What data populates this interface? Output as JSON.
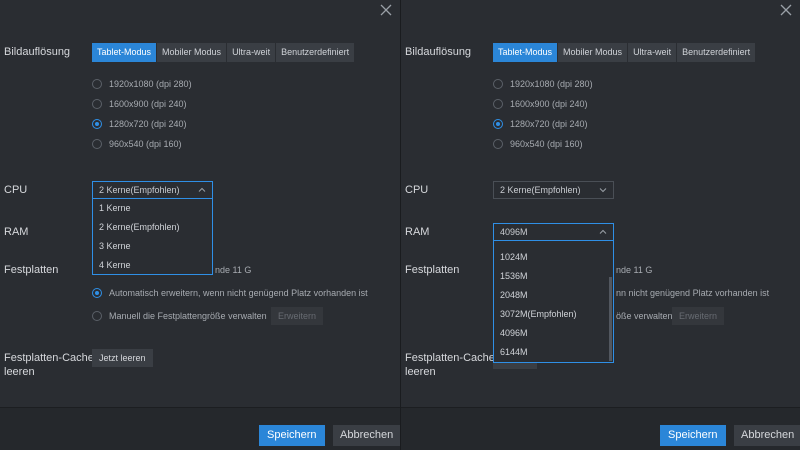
{
  "labels": {
    "resolution": "Bildauflösung",
    "cpu": "CPU",
    "ram": "RAM",
    "disks": "Festplatten",
    "cache_line1": "Festplatten-Cache",
    "cache_line2": "leeren"
  },
  "resolution_modes": [
    "Tablet-Modus",
    "Mobiler Modus",
    "Ultra-weit",
    "Benutzerdefiniert"
  ],
  "active_mode": "Tablet-Modus",
  "resolutions": [
    {
      "label": "1920x1080  (dpi 280)",
      "checked": false
    },
    {
      "label": "1600x900  (dpi 240)",
      "checked": false
    },
    {
      "label": "1280x720  (dpi 240)",
      "checked": true
    },
    {
      "label": "960x540  (dpi 160)",
      "checked": false
    }
  ],
  "cpu": {
    "value": "2 Kerne(Empfohlen)",
    "options": [
      "1 Kerne",
      "2 Kerne(Empfohlen)",
      "3 Kerne",
      "4 Kerne"
    ]
  },
  "ram": {
    "value": "4096M",
    "options": [
      "1024M",
      "1536M",
      "2048M",
      "3072M(Empfohlen)",
      "4096M",
      "6144M"
    ]
  },
  "disk": {
    "free_space_partial": "nde 11 G",
    "auto_expand_left": "Automatisch erweitern, wenn nicht genügend Platz vorhanden ist",
    "auto_expand_right": "nn nicht genügend Platz vorhanden ist",
    "manual_left": "Manuell die Festplattengröße verwalten",
    "manual_right": "öße verwalten",
    "expand_button": "Erweitern"
  },
  "cache": {
    "clear_button": "Jetzt leeren"
  },
  "footer": {
    "save": "Speichern",
    "cancel": "Abbrechen"
  },
  "colors": {
    "accent": "#2b86d8",
    "panel_bg": "#2a2d32"
  },
  "icons": {
    "close": "close-icon",
    "chevron_up": "chevron-up-icon",
    "chevron_down": "chevron-down-icon"
  }
}
